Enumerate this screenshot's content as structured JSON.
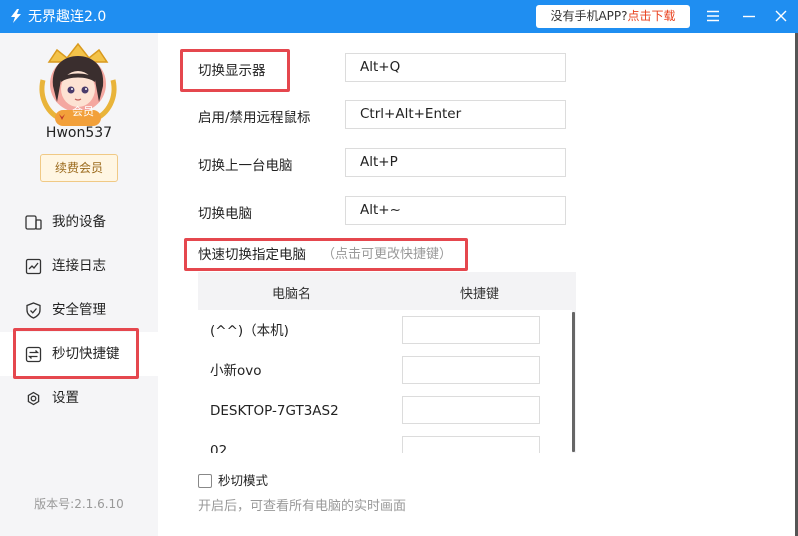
{
  "titlebar": {
    "app_title": "无界趣连2.0",
    "promo_prefix": "没有手机APP?",
    "promo_link": "点击下载",
    "menu_icon": "hamburger-menu-icon",
    "minimize_icon": "minimize-icon",
    "close_icon": "close-icon"
  },
  "sidebar": {
    "avatar_badge": "会员",
    "username": "Hwon537",
    "renew_label": "续费会员",
    "items": [
      {
        "label": "我的设备",
        "icon": "devices-icon"
      },
      {
        "label": "连接日志",
        "icon": "log-chart-icon"
      },
      {
        "label": "安全管理",
        "icon": "shield-icon"
      },
      {
        "label": "秒切快捷键",
        "icon": "switch-icon",
        "active": true
      },
      {
        "label": "设置",
        "icon": "gear-icon"
      }
    ],
    "version": "版本号:2.1.6.10"
  },
  "shortcuts": [
    {
      "label": "切换显示器",
      "key": "Alt+Q"
    },
    {
      "label": "启用/禁用远程鼠标",
      "key": "Ctrl+Alt+Enter"
    },
    {
      "label": "切换上一台电脑",
      "key": "Alt+P"
    },
    {
      "label": "切换电脑",
      "key": "Alt+~"
    }
  ],
  "quick_switch": {
    "title": "快速切换指定电脑",
    "hint": "（点击可更改快捷键）",
    "columns": [
      "电脑名",
      "快捷键"
    ],
    "rows": [
      {
        "name": "(^^)（本机)",
        "shortcut": ""
      },
      {
        "name": "小新ovo",
        "shortcut": ""
      },
      {
        "name": "DESKTOP-7GT3AS2",
        "shortcut": ""
      },
      {
        "name": "02",
        "shortcut": ""
      }
    ]
  },
  "instant_mode": {
    "label": "秒切模式",
    "checked": false,
    "description": "开启后，可查看所有电脑的实时画面"
  },
  "colors": {
    "titlebar": "#1f8ef1",
    "highlight": "#e5474e",
    "promo_link": "#e8411e"
  }
}
